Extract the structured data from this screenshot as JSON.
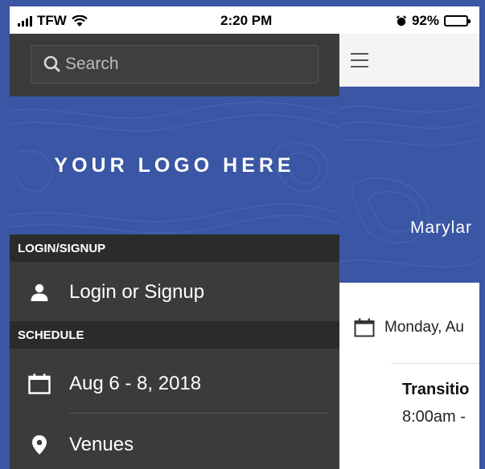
{
  "status_bar": {
    "carrier": "TFW",
    "time": "2:20 PM",
    "battery": "92%",
    "battery_level": 0.92
  },
  "drawer": {
    "search": {
      "placeholder": "Search"
    },
    "logo_text": "YOUR LOGO HERE",
    "sections": [
      {
        "header": "LOGIN/SIGNUP",
        "items": [
          {
            "label": "Login or Signup",
            "icon": "person-icon"
          }
        ]
      },
      {
        "header": "SCHEDULE",
        "items": [
          {
            "label": "Aug 6 - 8, 2018",
            "icon": "calendar-icon"
          },
          {
            "label": "Venues",
            "icon": "location-pin-icon"
          }
        ]
      }
    ]
  },
  "main": {
    "banner_title": "Marylar",
    "date_label": "Monday, Au",
    "event_title": "Transitio",
    "event_time": "8:00am -"
  },
  "colors": {
    "brand_blue": "#3a56a4",
    "drawer_bg": "#3b3b3b",
    "section_header_bg": "#2b2b2b"
  }
}
